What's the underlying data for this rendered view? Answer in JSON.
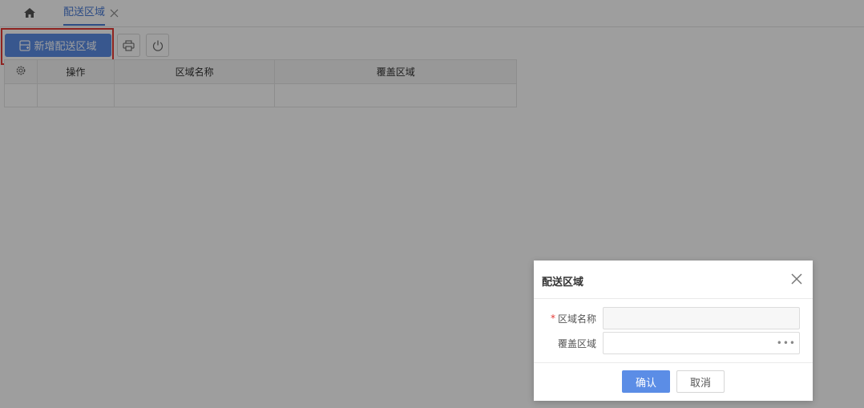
{
  "tabs": {
    "home_icon": "home-icon",
    "active_label": "配送区域",
    "close_icon": "close-icon"
  },
  "toolbar": {
    "add_label": "新增配送区域",
    "add_icon": "add-area-icon",
    "print_icon": "print-icon",
    "power_icon": "power-icon"
  },
  "table": {
    "settings_icon": "gear-icon",
    "columns": [
      "操作",
      "区域名称",
      "覆盖区域"
    ]
  },
  "dialog": {
    "title": "配送区域",
    "required_mark": "*",
    "name_label": "区域名称",
    "name_value": "",
    "cover_label": "覆盖区域",
    "cover_value": "",
    "more_glyph": "•••",
    "ok_label": "确认",
    "cancel_label": "取消"
  },
  "colors": {
    "accent": "#5b8de6",
    "tab_active": "#4a7bd6",
    "highlight": "#e53935",
    "required": "#e53935"
  }
}
